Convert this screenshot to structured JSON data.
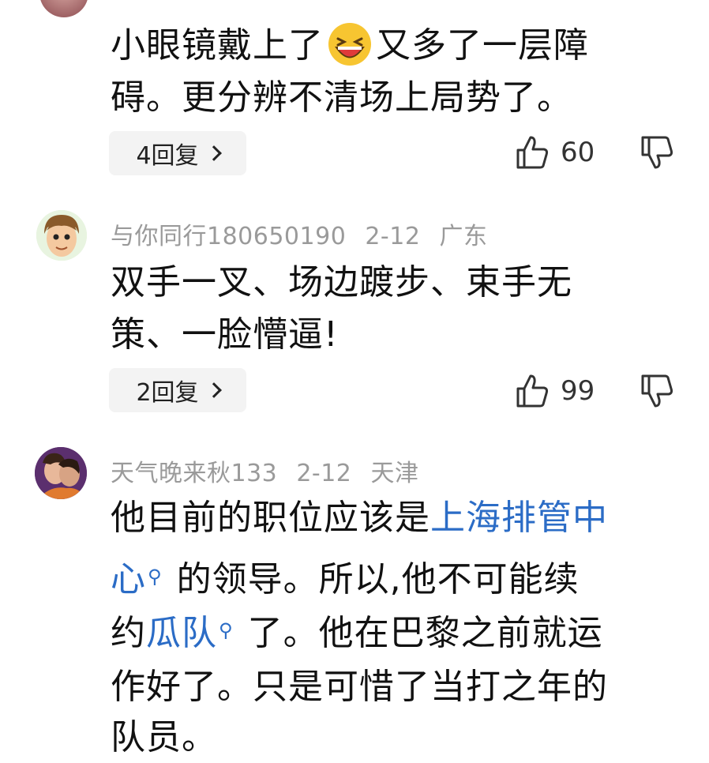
{
  "comment1": {
    "line1_a": "小眼镜戴上了",
    "emoji": "grinning-squint-emoji",
    "line1_b": "又多了一层障",
    "line2": "碍。更分辨不清场上局势了。",
    "reply_label": "4回复",
    "likes": "60"
  },
  "comment2": {
    "username": "与你同行180650190",
    "date": "2-12",
    "location": "广东",
    "line1": "双手一叉、场边踱步、束手无",
    "line2": "策、一脸懵逼!",
    "reply_label": "2回复",
    "likes": "99"
  },
  "comment3": {
    "username": "天气晚来秋133",
    "date": "2-12",
    "location": "天津",
    "line1_a": "他目前的职位应该是",
    "link1_a": "上海排管中",
    "link1_b": "心",
    "line2_b": "的领导。所以,他不可能续",
    "line3_a": "约",
    "link2": "瓜队",
    "line3_b": "了。他在巴黎之前就运",
    "line4": "作好了。只是可惜了当打之年的",
    "line5": "队员。"
  },
  "colors": {
    "link": "#2b6cc6",
    "meta": "#9a9a9a",
    "reply_bg": "#f3f3f3"
  }
}
